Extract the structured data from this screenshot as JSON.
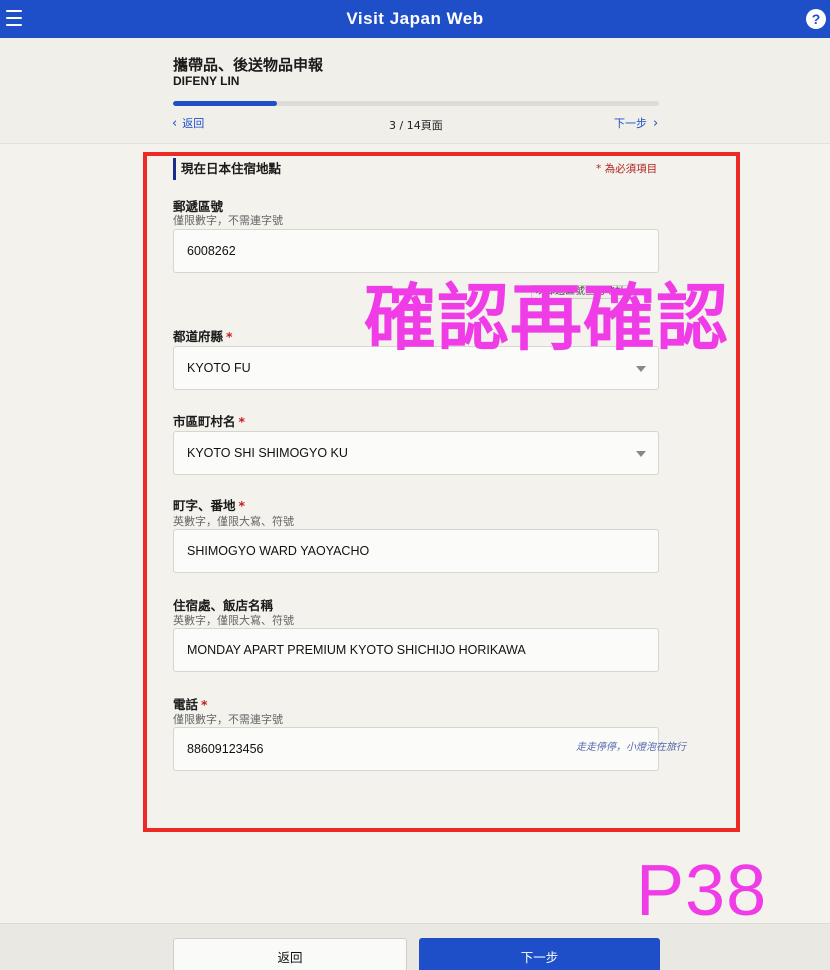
{
  "app": {
    "title": "Visit Japan Web",
    "help_label": "?"
  },
  "header": {
    "page_title": "攜帶品、後送物品申報",
    "user_name": "DIFENY LIN",
    "progress": {
      "current": 3,
      "total": 14,
      "fraction": 0.214
    },
    "back_label": "返回",
    "next_label": "下一步",
    "page_count": "3 / 14頁面"
  },
  "section": {
    "title": "現在日本住宿地點",
    "required_note": "* 為必須項目"
  },
  "fields": {
    "postal": {
      "label": "郵遞區號",
      "hint": "僅限數字，不需連字號",
      "value": "6008262",
      "lookup_label": "以郵遞區號查詢地址"
    },
    "prefecture": {
      "label": "都道府縣",
      "value": "KYOTO FU"
    },
    "city": {
      "label": "市區町村名",
      "value": "KYOTO SHI SHIMOGYO KU"
    },
    "street": {
      "label": "町字、番地",
      "hint": "英數字，僅限大寫、符號",
      "value": "SHIMOGYO WARD YAOYACHO"
    },
    "hotel": {
      "label": "住宿處、飯店名稱",
      "hint": "英數字，僅限大寫、符號",
      "value": "MONDAY APART PREMIUM KYOTO SHICHIJO HORIKAWA"
    },
    "phone": {
      "label": "電話",
      "hint": "僅限數字，不需連字號",
      "value": "88609123456"
    }
  },
  "required_star": "*",
  "annotations": {
    "stamp": "確認再確認",
    "page_label": "P38",
    "watermark": "走走停停，小燈泡在旅行"
  },
  "footer": {
    "back_label": "返回",
    "next_label": "下一步"
  },
  "colors": {
    "brand": "#1f4fc8",
    "highlight_frame": "#ee2a24",
    "annotation_magenta": "#f03ce6",
    "required_red": "#c0211e"
  },
  "icons": {
    "menu": "hamburger-menu-icon",
    "help": "help-circle-icon",
    "back": "chevron-left-icon",
    "next": "chevron-right-icon",
    "select": "caret-down-icon"
  }
}
